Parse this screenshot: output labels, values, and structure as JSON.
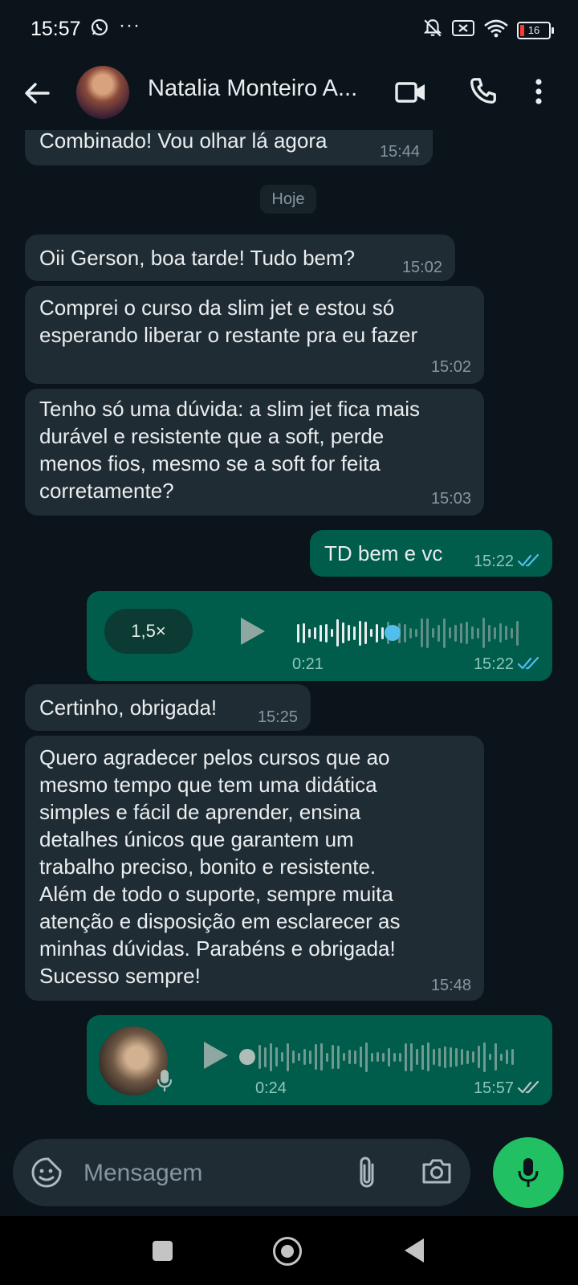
{
  "status_bar": {
    "time": "15:57",
    "more": "···",
    "battery": "16"
  },
  "header": {
    "contact_name": "Natalia Monteiro A..."
  },
  "chat": {
    "prev_message": {
      "text": "Combinado! Vou olhar lá agora",
      "time": "15:44"
    },
    "date_label": "Hoje",
    "msg1": {
      "text": "Oii Gerson, boa tarde! Tudo bem?",
      "time": "15:02"
    },
    "msg2": {
      "line1": "Comprei o curso da slim jet e estou só",
      "line2": "esperando liberar o restante pra eu fazer",
      "time": "15:02"
    },
    "msg3": {
      "line1": "Tenho só uma dúvida: a slim jet fica mais",
      "line2": "durável e resistente que a soft, perde",
      "line3": "menos fios, mesmo se a soft for feita",
      "line4": "corretamente?",
      "time": "15:03"
    },
    "msg4": {
      "text": "TD bem e vc",
      "time": "15:22"
    },
    "audio1": {
      "speed": "1,5×",
      "duration": "0:21",
      "time": "15:22",
      "progress": 0.41
    },
    "msg5": {
      "text": "Certinho, obrigada!",
      "time": "15:25"
    },
    "msg6": {
      "line1": "Quero agradecer pelos cursos que ao",
      "line2": "mesmo tempo que tem uma didática",
      "line3": "simples e fácil de aprender, ensina",
      "line4": "detalhes únicos que garantem um",
      "line5": "trabalho preciso, bonito e resistente.",
      "line6": "Além de todo o suporte, sempre muita",
      "line7": "atenção e disposição em esclarecer as",
      "line8": "minhas dúvidas. Parabéns e obrigada!",
      "line9": "Sucesso sempre!",
      "time": "15:48"
    },
    "audio2": {
      "duration": "0:24",
      "time": "15:57",
      "progress": 0
    }
  },
  "input": {
    "placeholder": "Mensagem"
  },
  "colors": {
    "incoming": "#202c33",
    "outgoing": "#005c4b",
    "accent": "#21c063",
    "read_tick": "#53bdeb",
    "sent_tick": "#b6c9c4"
  }
}
